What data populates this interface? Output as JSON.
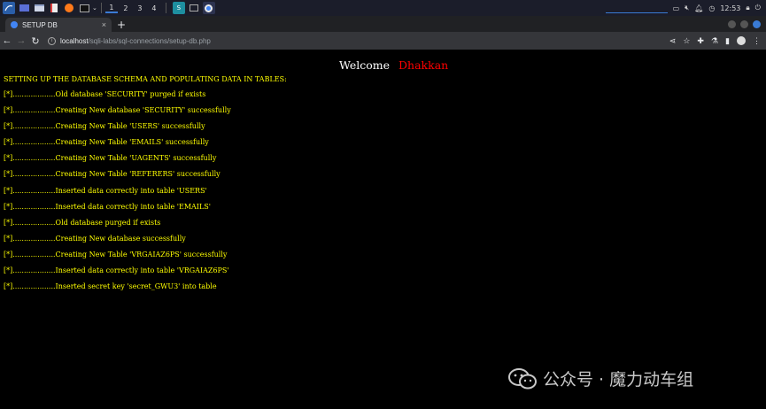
{
  "taskbar": {
    "workspaces": [
      "1",
      "2",
      "3",
      "4"
    ],
    "clock": "12:53"
  },
  "browser": {
    "tab_title": "SETUP DB",
    "new_tab": "+",
    "tab_close": "×",
    "url_host": "localhost",
    "url_path": "/sqli-labs/sql-connections/setup-db.php"
  },
  "page": {
    "welcome_label": "Welcome",
    "welcome_name": "Dhakkan",
    "heading": "SETTING UP THE DATABASE SCHEMA AND POPULATING DATA IN TABLES:",
    "log_lines": [
      "[*]...................Old database 'SECURITY' purged if exists",
      "[*]...................Creating New database 'SECURITY' successfully",
      "[*]...................Creating New Table 'USERS' successfully",
      "[*]...................Creating New Table 'EMAILS' successfully",
      "[*]...................Creating New Table 'UAGENTS' successfully",
      "[*]...................Creating New Table 'REFERERS' successfully",
      "[*]...................Inserted data correctly into table 'USERS'",
      "[*]...................Inserted data correctly into table 'EMAILS'",
      "[*]...................Old database purged if exists",
      "[*]...................Creating New database successfully",
      "[*]...................Creating New Table 'VRGAIAZ6PS' successfully",
      "[*]...................Inserted data correctly into table 'VRGAIAZ6PS'",
      "[*]...................Inserted secret key 'secret_GWU3' into table"
    ]
  },
  "watermark": {
    "text": "公众号 · 魔力动车组"
  },
  "colors": {
    "page_bg": "#000000",
    "log_text": "#ffff00",
    "welcome_name": "#ff0000",
    "accent": "#3a7bd5"
  }
}
